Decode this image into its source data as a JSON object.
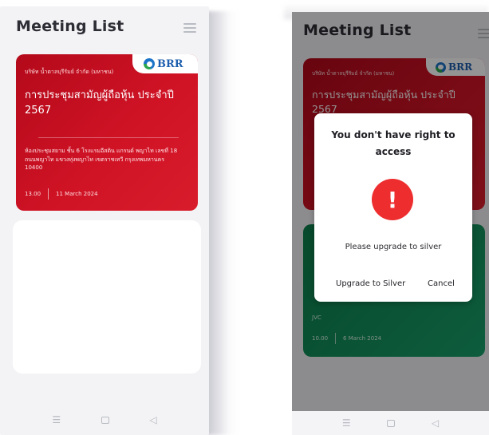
{
  "app": {
    "header_title": "Meeting List",
    "menu_icon": "hamburger-menu-icon"
  },
  "meeting": {
    "company": "บริษัท น้ำตาลบุรีรัมย์ จำกัด (มหาชน)",
    "logo_text": "BRR",
    "title": "การประชุมสามัญผู้ถือหุ้น ประจำปี 2567",
    "venue": "ห้องประชุมสยาม ชั้น 6 โรงแรมอีสติน แกรนด์ พญาไท เลขที่ 18 ถนนพญาไท แขวงทุ่งพญาไท เขตราชเทวี กรุงเทพมหานคร 10400",
    "time": "13.00",
    "date": "11 March 2024",
    "accent_color": "#cf1325"
  },
  "second_meeting": {
    "company_short": "JVC",
    "time": "10.00",
    "date": "6 March 2024",
    "accent_color": "#17a06a"
  },
  "dialog": {
    "title": "You don't have right to access",
    "icon": "exclamation-warning-icon",
    "message": "Please upgrade to silver",
    "primary_label": "Upgrade to Silver",
    "cancel_label": "Cancel",
    "icon_color": "#ee2d2f"
  },
  "navbar": {
    "menu": "☰",
    "back": "◁"
  }
}
